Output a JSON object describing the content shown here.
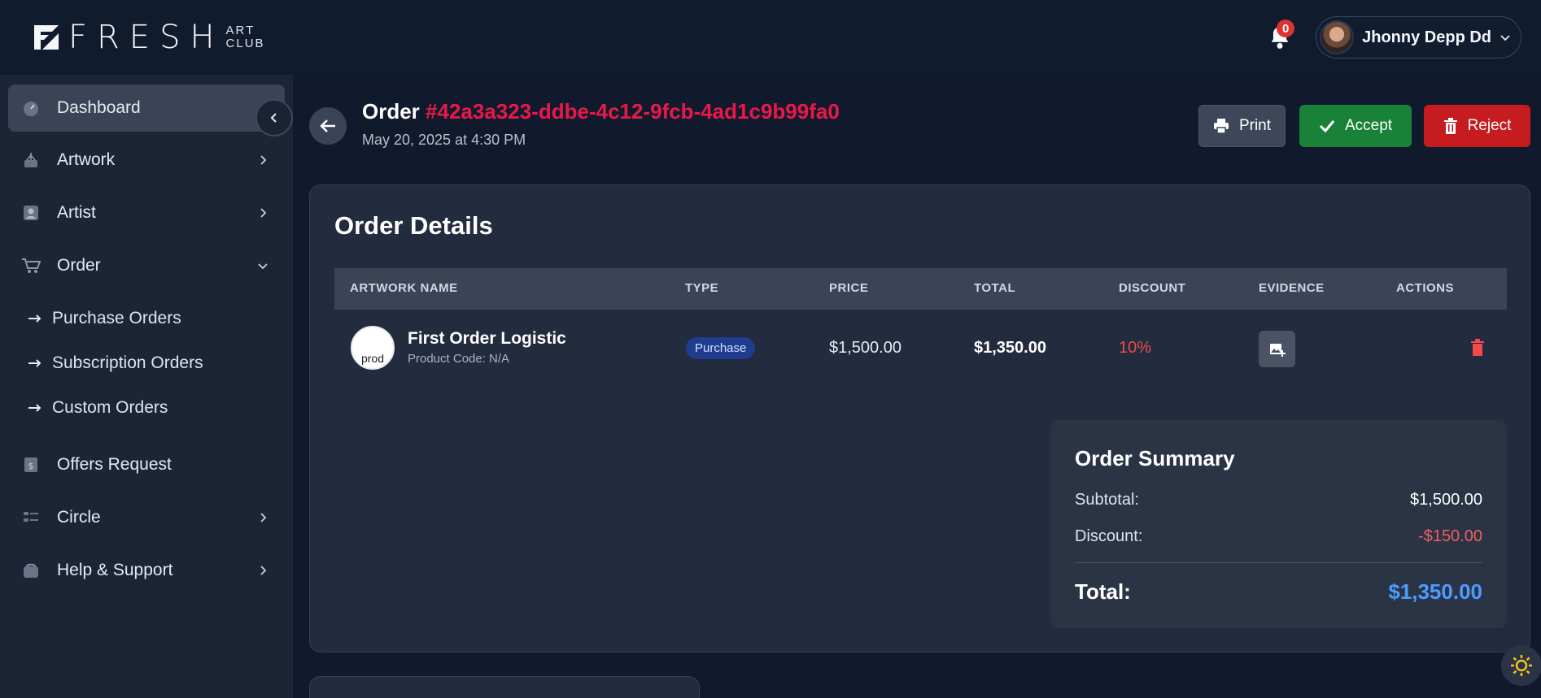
{
  "brand": {
    "name": "FRESH",
    "sub_top": "ART",
    "sub_bottom": "CLUB"
  },
  "header": {
    "notification_count": "0",
    "user_name": "Jhonny Depp Dd"
  },
  "sidebar": {
    "items": [
      {
        "label": "Dashboard",
        "icon": "gauge-icon"
      },
      {
        "label": "Artwork",
        "icon": "easel-icon"
      },
      {
        "label": "Artist",
        "icon": "user-icon"
      },
      {
        "label": "Order",
        "icon": "cart-icon"
      },
      {
        "label": "Offers Request",
        "icon": "offer-icon"
      },
      {
        "label": "Circle",
        "icon": "list-icon"
      },
      {
        "label": "Help & Support",
        "icon": "support-icon"
      }
    ],
    "order_sub": [
      {
        "label": "Purchase Orders"
      },
      {
        "label": "Subscription Orders"
      },
      {
        "label": "Custom Orders"
      }
    ]
  },
  "order": {
    "title_prefix": "Order",
    "id": "#42a3a323-ddbe-4c12-9fcb-4ad1c9b99fa0",
    "date": "May 20, 2025 at 4:30 PM"
  },
  "actions": {
    "print": "Print",
    "accept": "Accept",
    "reject": "Reject"
  },
  "details": {
    "title": "Order Details",
    "columns": [
      "ARTWORK NAME",
      "TYPE",
      "PRICE",
      "TOTAL",
      "DISCOUNT",
      "EVIDENCE",
      "ACTIONS"
    ],
    "rows": [
      {
        "thumb_alt": "prod",
        "name": "First Order Logistic",
        "code": "Product Code: N/A",
        "type": "Purchase",
        "price": "$1,500.00",
        "total": "$1,350.00",
        "discount": "10%"
      }
    ]
  },
  "summary": {
    "title": "Order Summary",
    "subtotal_label": "Subtotal:",
    "subtotal": "$1,500.00",
    "discount_label": "Discount:",
    "discount": "-$150.00",
    "total_label": "Total:",
    "total": "$1,350.00"
  },
  "colors": {
    "accent_red": "#e8194a",
    "accept_green": "#198238",
    "reject_red": "#c61b1f",
    "total_blue": "#4d9bff"
  }
}
